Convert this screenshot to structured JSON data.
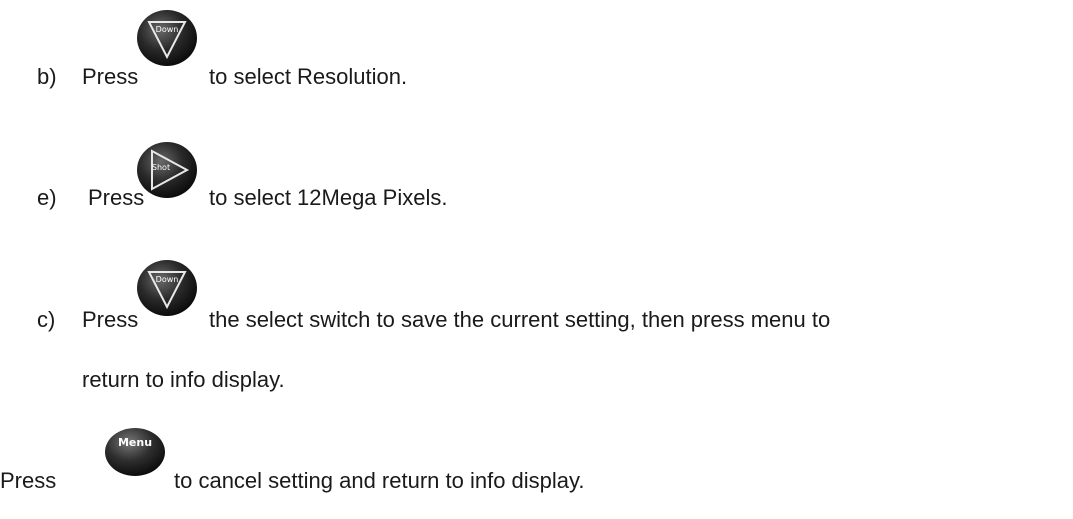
{
  "steps": [
    {
      "marker": "b)",
      "press": "Press",
      "icon": "down-button-icon",
      "icon_label": "Down",
      "text": "to select Resolution."
    },
    {
      "marker": "e)",
      "press": "Press",
      "icon": "shot-button-icon",
      "icon_label": "Shot",
      "text": "to select 12Mega Pixels."
    },
    {
      "marker": "c)",
      "press": "Press",
      "icon": "down-button-icon",
      "icon_label": "Down",
      "text": "the select switch to save the current setting, then press menu to",
      "text_cont": "return to info display."
    }
  ],
  "note": {
    "press": "Press",
    "icon": "menu-button-icon",
    "icon_label": "Menu",
    "text": "to cancel setting and return to info display."
  }
}
